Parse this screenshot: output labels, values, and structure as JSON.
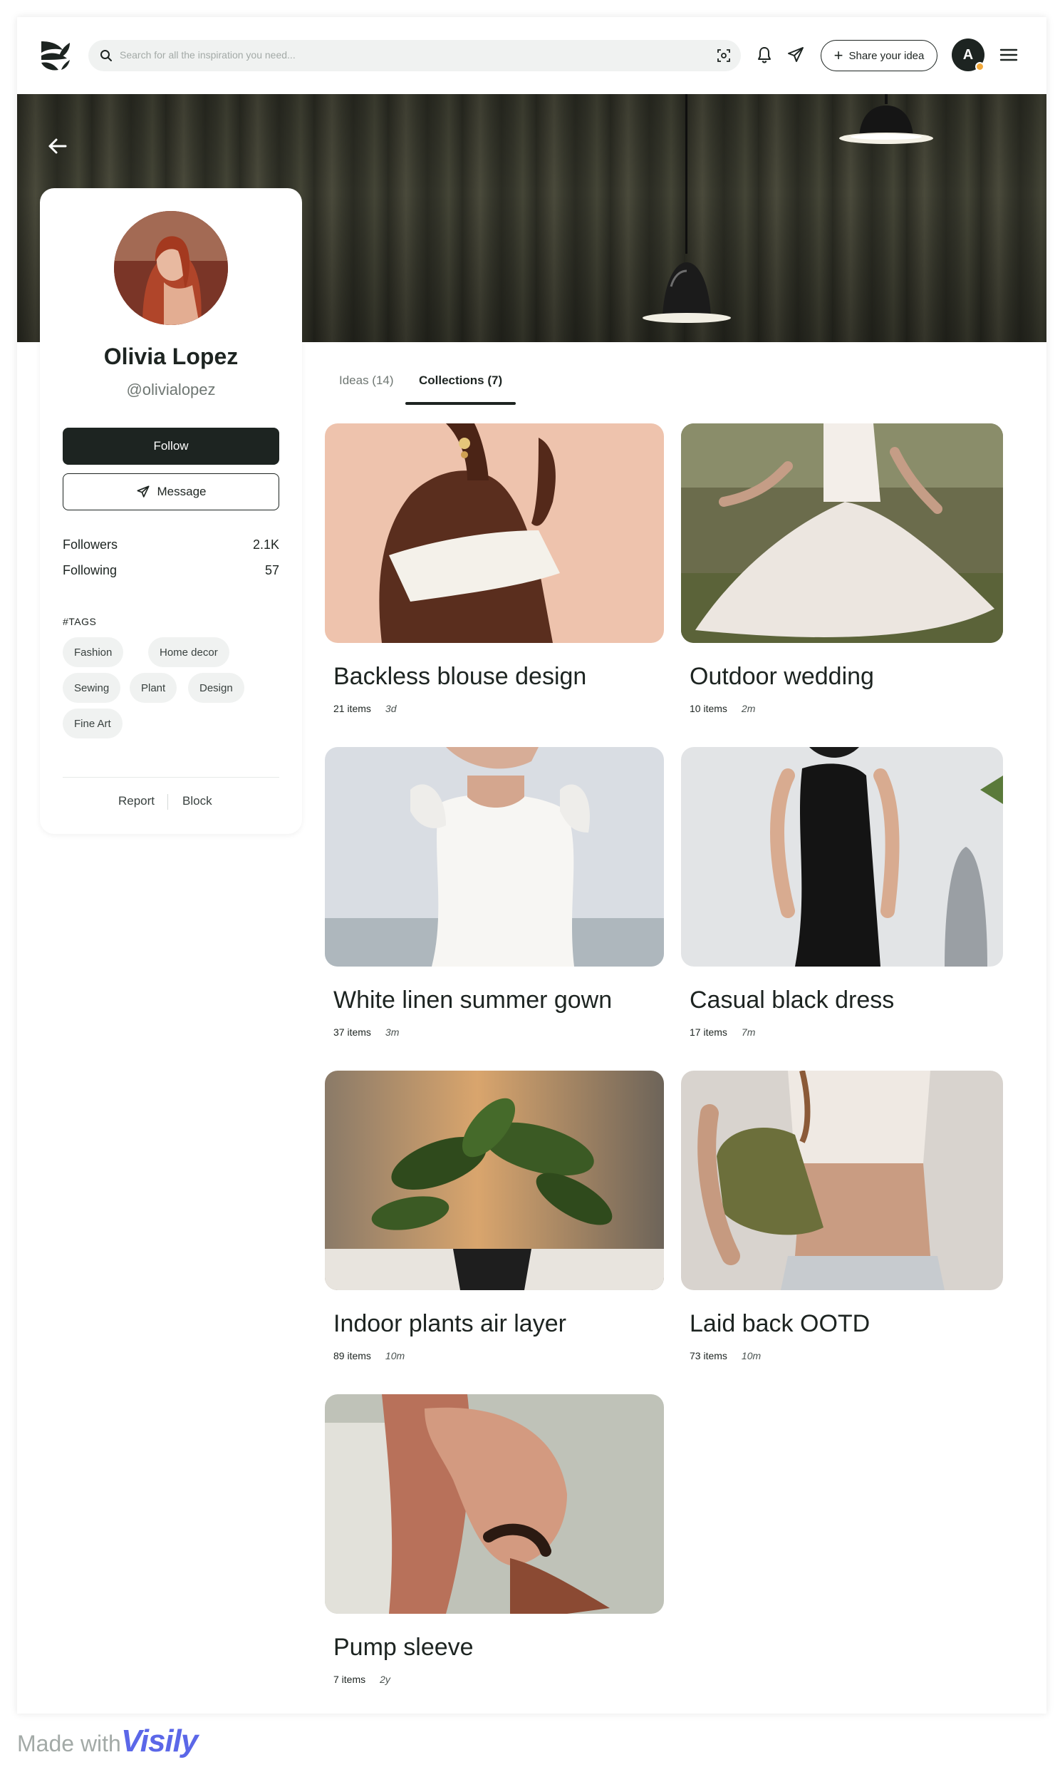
{
  "header": {
    "search_placeholder": "Search for all the inspiration you need...",
    "share_label": "Share your idea",
    "avatar_initial": "A"
  },
  "profile": {
    "name": "Olivia Lopez",
    "handle": "@olivialopez",
    "follow_label": "Follow",
    "message_label": "Message",
    "stats": [
      {
        "label": "Followers",
        "value": "2.1K"
      },
      {
        "label": "Following",
        "value": "57"
      }
    ],
    "tags_title": "#TAGS",
    "tags": [
      "Fashion",
      "Home decor",
      "Sewing",
      "Plant",
      "Design",
      "Fine Art"
    ],
    "report_label": "Report",
    "block_label": "Block"
  },
  "tabs": [
    {
      "label": "Ideas (14)",
      "active": false
    },
    {
      "label": "Collections (7)",
      "active": true
    }
  ],
  "collections": [
    {
      "title": "Backless blouse design",
      "items": "21 items",
      "age": "3d"
    },
    {
      "title": "Outdoor wedding",
      "items": "10 items",
      "age": "2m"
    },
    {
      "title": "White linen summer gown",
      "items": "37 items",
      "age": "3m"
    },
    {
      "title": "Casual black dress",
      "items": "17 items",
      "age": "7m"
    },
    {
      "title": "Indoor plants air layer",
      "items": "89 items",
      "age": "10m"
    },
    {
      "title": "Laid back OOTD",
      "items": "73 items",
      "age": "10m"
    },
    {
      "title": "Pump sleeve",
      "items": "7 items",
      "age": "2y"
    }
  ],
  "footer": {
    "made_with": "Made with",
    "brand": "Visily"
  },
  "colors": {
    "primary": "#1d2421",
    "accent_dot": "#f2a93b",
    "brand": "#5b67e8",
    "chip_bg": "#f0f2f1"
  }
}
